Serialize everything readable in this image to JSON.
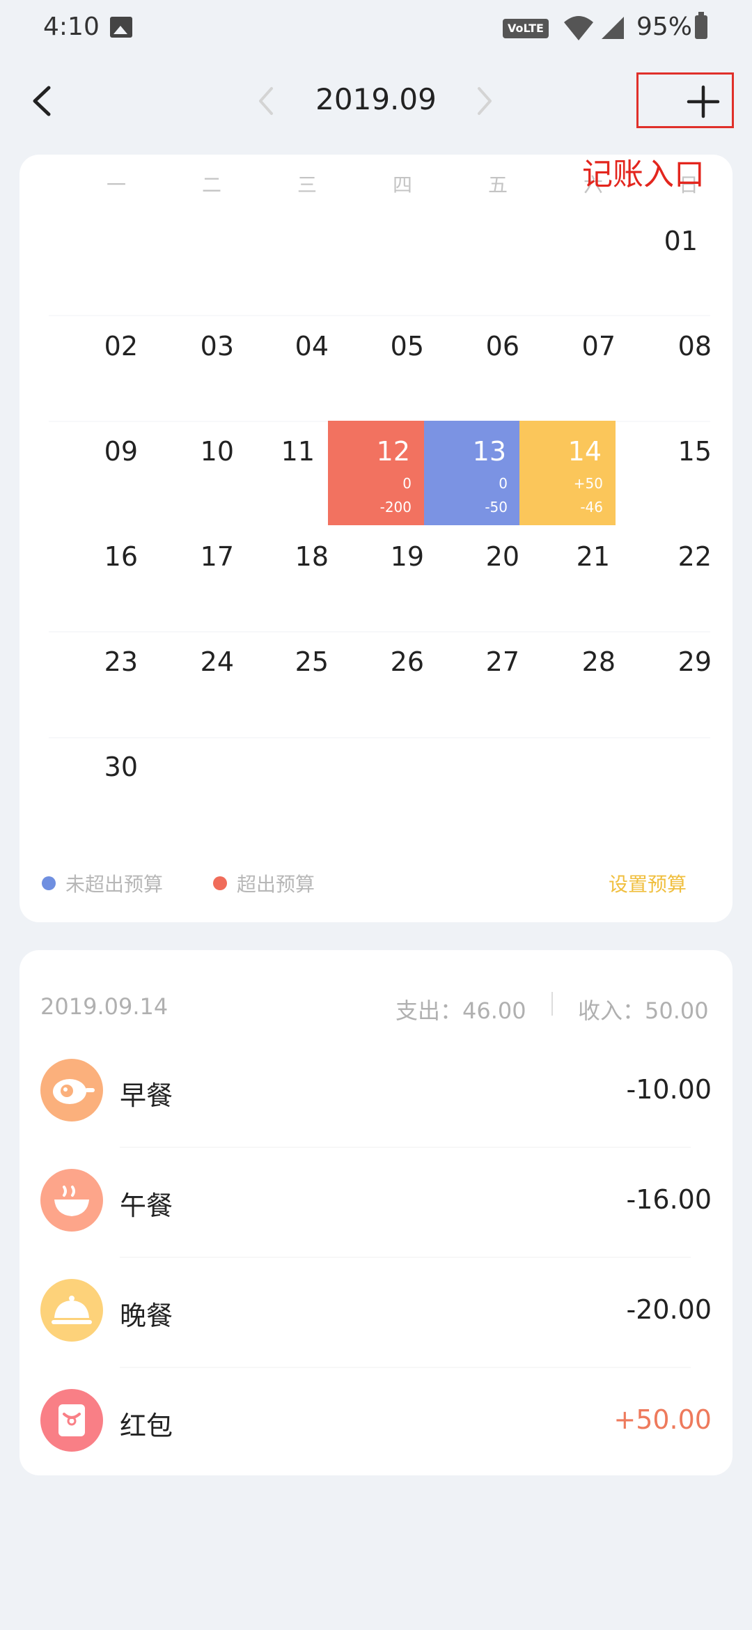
{
  "status_bar": {
    "time": "4:10",
    "volte": "VoLTE",
    "battery": "95%"
  },
  "nav": {
    "month": "2019.09",
    "add_annotation": "记账入口"
  },
  "calendar": {
    "weekdays": [
      "一",
      "二",
      "三",
      "四",
      "五",
      "六",
      "日"
    ],
    "days": {
      "d01": "01",
      "d02": "02",
      "d03": "03",
      "d04": "04",
      "d05": "05",
      "d06": "06",
      "d07": "07",
      "d08": "08",
      "d09": "09",
      "d10": "10",
      "d11": "11",
      "d12": "12",
      "d13": "13",
      "d14": "14",
      "d15": "15",
      "d16": "16",
      "d17": "17",
      "d18": "18",
      "d19": "19",
      "d20": "20",
      "d21": "21",
      "d22": "22",
      "d23": "23",
      "d24": "24",
      "d25": "25",
      "d26": "26",
      "d27": "27",
      "d28": "28",
      "d29": "29",
      "d30": "30"
    },
    "highlights": {
      "d12": {
        "income": "0",
        "expense": "-200",
        "color": "#f27260"
      },
      "d13": {
        "income": "0",
        "expense": "-50",
        "color": "#7b93e3"
      },
      "d14": {
        "income": "+50",
        "expense": "-46",
        "color": "#fbc65a"
      }
    },
    "legend": {
      "under_budget": "未超出预算",
      "under_color": "#6f8fe0",
      "over_budget": "超出预算",
      "over_color": "#f06c5a",
      "set_budget": "设置预算"
    }
  },
  "detail": {
    "date": "2019.09.14",
    "expense": "支出：46.00",
    "income": "收入：50.00",
    "transactions": [
      {
        "name": "早餐",
        "amount": "-10.00",
        "icon": "egg-icon",
        "color": "#fbb07c"
      },
      {
        "name": "午餐",
        "amount": "-16.00",
        "icon": "bowl-icon",
        "color": "#fda58a"
      },
      {
        "name": "晚餐",
        "amount": "-20.00",
        "icon": "cloche-icon",
        "color": "#fdd27a"
      },
      {
        "name": "红包",
        "amount": "+50.00",
        "icon": "red-envelope-icon",
        "color": "#f97f86"
      }
    ]
  }
}
